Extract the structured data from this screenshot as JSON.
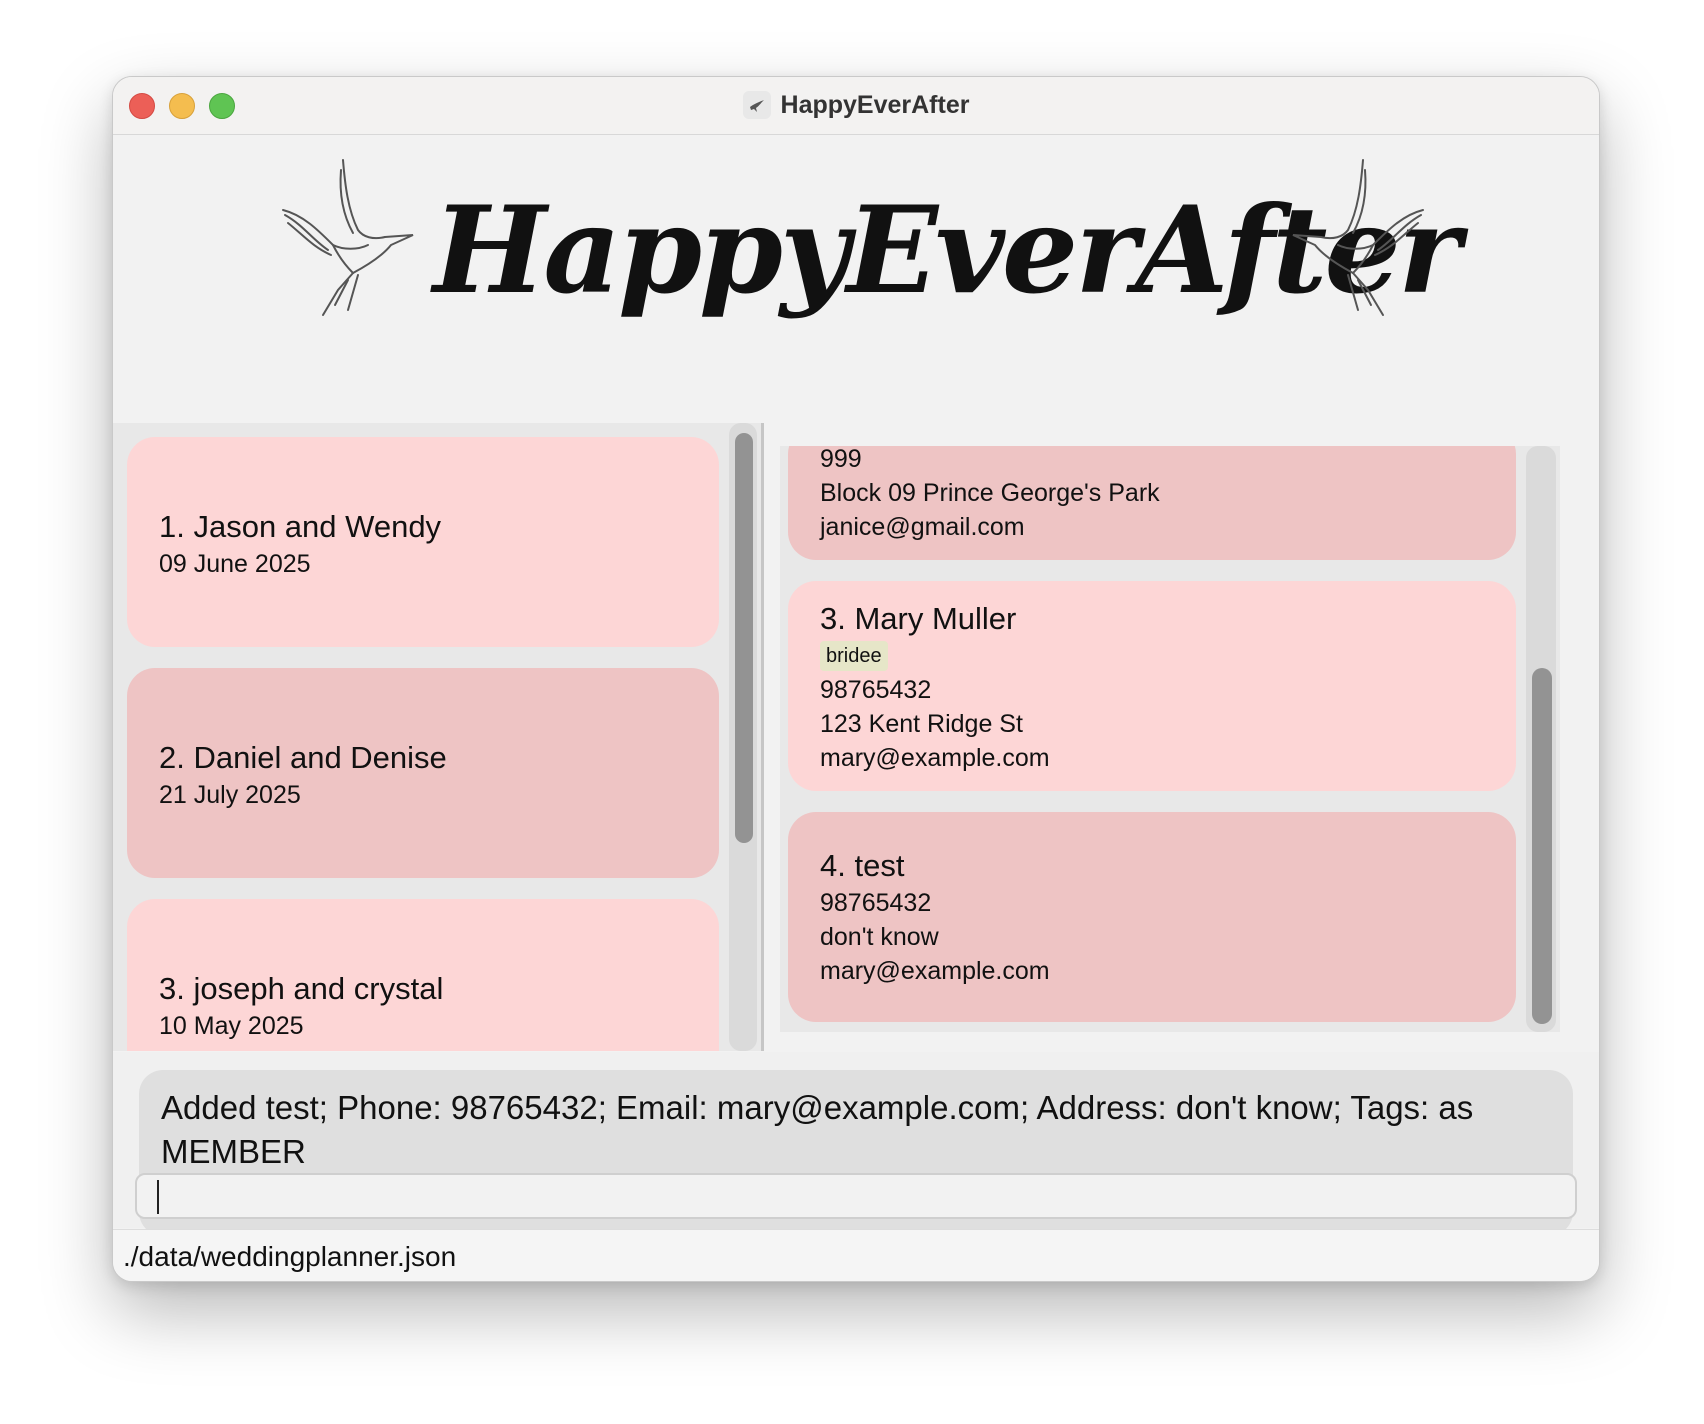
{
  "window": {
    "title": "HappyEverAfter"
  },
  "banner": {
    "text": "HappyEverAfter"
  },
  "weddings": [
    {
      "title": "1. Jason and Wendy",
      "date": "09 June 2025"
    },
    {
      "title": "2. Daniel and Denise",
      "date": "21 July 2025"
    },
    {
      "title": "3. joseph and crystal",
      "date": "10 May 2025"
    }
  ],
  "persons": [
    {
      "phone": "999",
      "address": "Block 09 Prince George's Park",
      "email": "janice@gmail.com"
    },
    {
      "title": "3. Mary Muller",
      "tag": "bridee",
      "phone": "98765432",
      "address": "123 Kent Ridge St",
      "email": "mary@example.com"
    },
    {
      "title": "4. test",
      "phone": "98765432",
      "address": "don't know",
      "email": "mary@example.com"
    }
  ],
  "result": {
    "message": "Added test; Phone: 98765432; Email: mary@example.com; Address: don't know; Tags:  as MEMBER"
  },
  "command": {
    "value": ""
  },
  "status": {
    "path": "./data/weddingplanner.json"
  },
  "colors": {
    "card_light": "#fdd6d6",
    "card_dark": "#eec4c4",
    "tag_bg": "#e6e6c8"
  },
  "icons": [
    "app-icon",
    "dove-icon"
  ]
}
